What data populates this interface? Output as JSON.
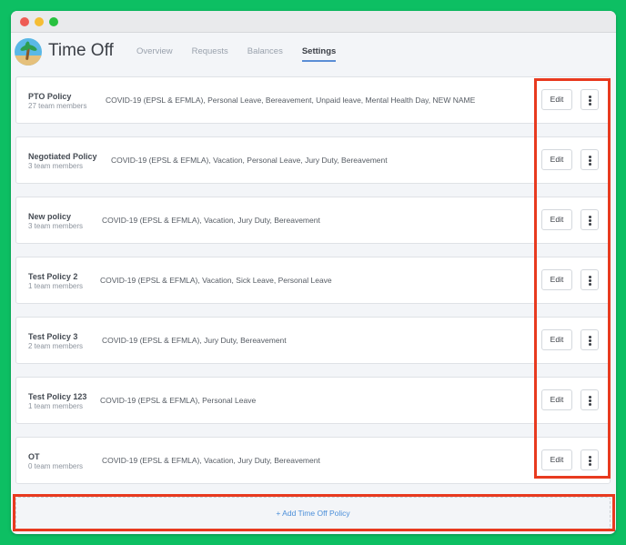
{
  "app": {
    "title": "Time Off"
  },
  "tabs": [
    {
      "label": "Overview",
      "active": false
    },
    {
      "label": "Requests",
      "active": false
    },
    {
      "label": "Balances",
      "active": false
    },
    {
      "label": "Settings",
      "active": true
    }
  ],
  "policies": [
    {
      "name": "PTO Policy",
      "members": "27 team members",
      "types": "COVID-19 (EPSL & EFMLA), Personal Leave, Bereavement, Unpaid leave, Mental Health Day, NEW NAME",
      "edit_label": "Edit"
    },
    {
      "name": "Negotiated Policy",
      "members": "3 team members",
      "types": "COVID-19 (EPSL & EFMLA), Vacation, Personal Leave, Jury Duty, Bereavement",
      "edit_label": "Edit"
    },
    {
      "name": "New policy",
      "members": "3 team members",
      "types": "COVID-19 (EPSL & EFMLA), Vacation, Jury Duty, Bereavement",
      "edit_label": "Edit"
    },
    {
      "name": "Test Policy 2",
      "members": "1 team members",
      "types": "COVID-19 (EPSL & EFMLA), Vacation, Sick Leave, Personal Leave",
      "edit_label": "Edit"
    },
    {
      "name": "Test Policy 3",
      "members": "2 team members",
      "types": "COVID-19 (EPSL & EFMLA), Jury Duty, Bereavement",
      "edit_label": "Edit"
    },
    {
      "name": "Test Policy 123",
      "members": "1 team members",
      "types": "COVID-19 (EPSL & EFMLA), Personal Leave",
      "edit_label": "Edit"
    },
    {
      "name": "OT",
      "members": "0 team members",
      "types": "COVID-19 (EPSL & EFMLA), Vacation, Jury Duty, Bereavement",
      "edit_label": "Edit"
    }
  ],
  "add_policy": {
    "label": "+ Add Time Off Policy"
  },
  "colors": {
    "window_bg": "#f3f5f8",
    "accent": "#4c8fd9",
    "highlight": "#e83a1f",
    "backdrop": "#0dbf63"
  },
  "icons": {
    "app_logo": "beach-palm-icon",
    "more": "vertical-dots-icon"
  }
}
